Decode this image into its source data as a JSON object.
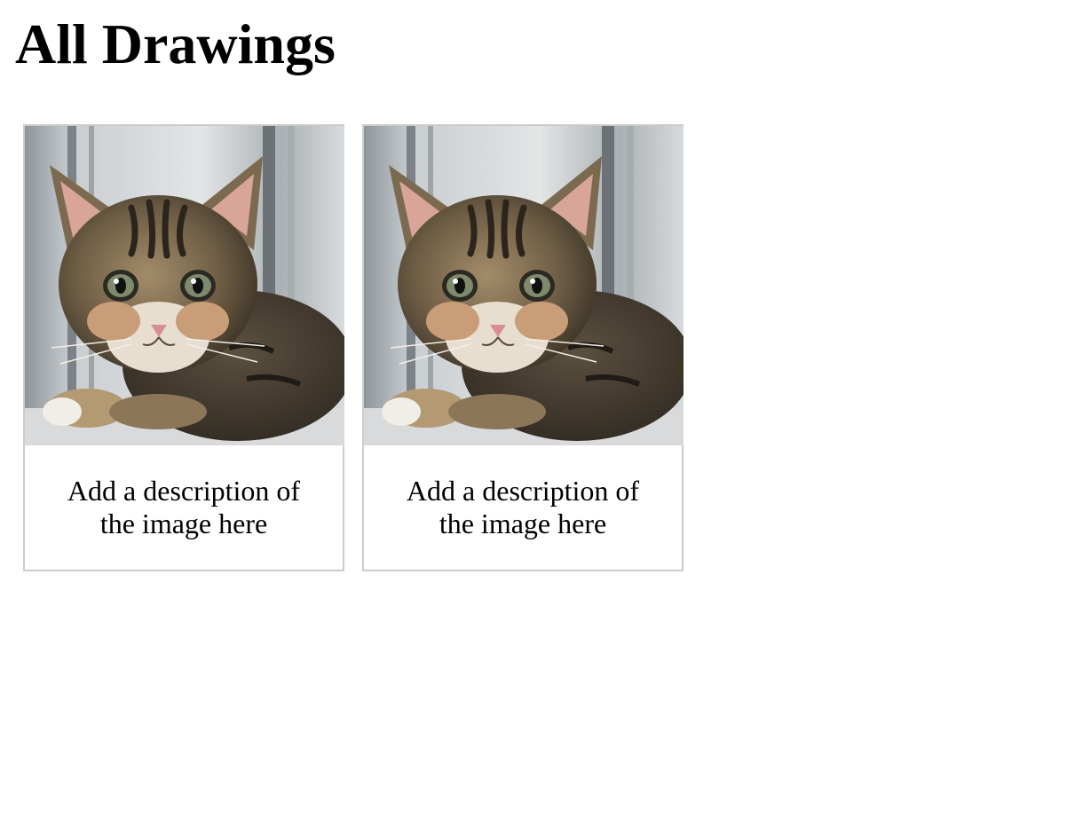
{
  "page": {
    "title": "All Drawings"
  },
  "gallery": {
    "items": [
      {
        "image_icon": "kitten-photo-icon",
        "description": "Add a description of the image here"
      },
      {
        "image_icon": "kitten-photo-icon",
        "description": "Add a description of the image here"
      }
    ]
  },
  "colors": {
    "card_border": "#cccccc",
    "background": "#ffffff",
    "text": "#000000"
  }
}
